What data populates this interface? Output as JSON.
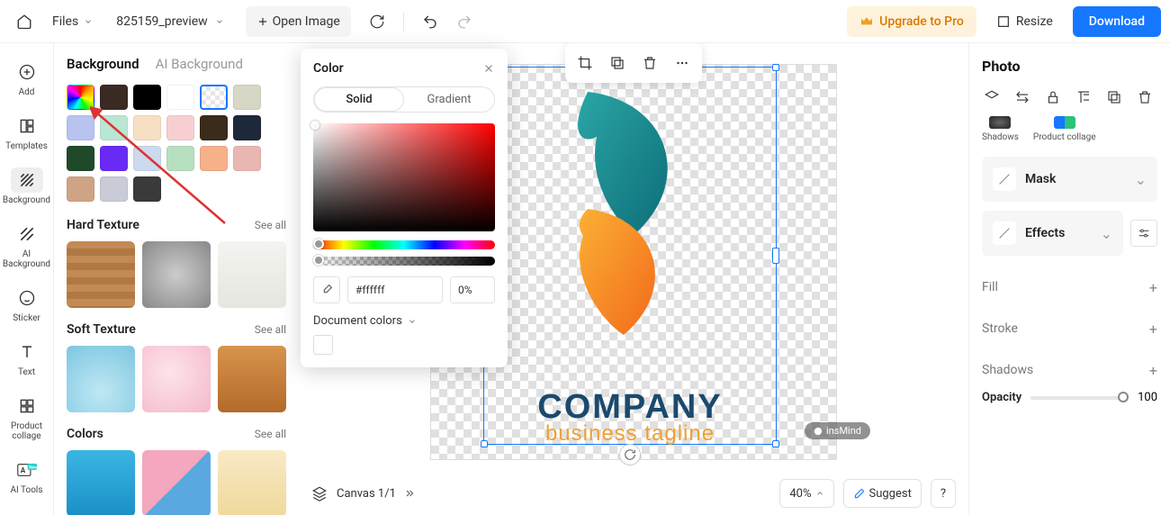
{
  "topbar": {
    "files_label": "Files",
    "doc_name": "825159_preview",
    "open_image": "Open Image",
    "upgrade": "Upgrade to Pro",
    "resize": "Resize",
    "download": "Download"
  },
  "sidenav": {
    "add": "Add",
    "templates": "Templates",
    "background": "Background",
    "ai_background": "AI Background",
    "sticker": "Sticker",
    "text": "Text",
    "product_collage": "Product collage",
    "ai_tools": "AI Tools"
  },
  "bg_panel": {
    "tab_background": "Background",
    "tab_ai": "AI Background",
    "swatches_row1": [
      "rainbow",
      "#3a2a24",
      "#000000",
      "#ffffff",
      "transparent",
      "#d8d6c4",
      "#b9c3ef"
    ],
    "swatches_row2": [
      "#b9e7d4",
      "#f7dfc4",
      "#f7cfd0",
      "#3a2b1a",
      "#1d2838",
      "#1f4a29"
    ],
    "swatches_row3": [
      "#6a2af5",
      "#cdd9ee",
      "#b7e0c0",
      "#f6b08a",
      "#e9b7b2",
      "#cfa484",
      "#c9cbd6"
    ],
    "swatches_row4": [
      "#3a3a3a"
    ],
    "hard_texture": "Hard Texture",
    "soft_texture": "Soft Texture",
    "colors": "Colors",
    "see_all": "See all"
  },
  "color_popover": {
    "title": "Color",
    "solid": "Solid",
    "gradient": "Gradient",
    "hex": "#ffffff",
    "alpha": "0%",
    "doc_colors": "Document colors"
  },
  "canvas": {
    "brand1": "COMPANY",
    "brand2": "business tagline",
    "watermark": "insMind",
    "canvas_label": "Canvas 1/1",
    "zoom": "40%",
    "suggest": "Suggest",
    "help": "?"
  },
  "right_panel": {
    "title": "Photo",
    "mini_shadows": "Shadows",
    "mini_collage": "Product collage",
    "mask": "Mask",
    "effects": "Effects",
    "fill": "Fill",
    "stroke": "Stroke",
    "shadows": "Shadows",
    "opacity_label": "Opacity",
    "opacity_value": "100"
  }
}
